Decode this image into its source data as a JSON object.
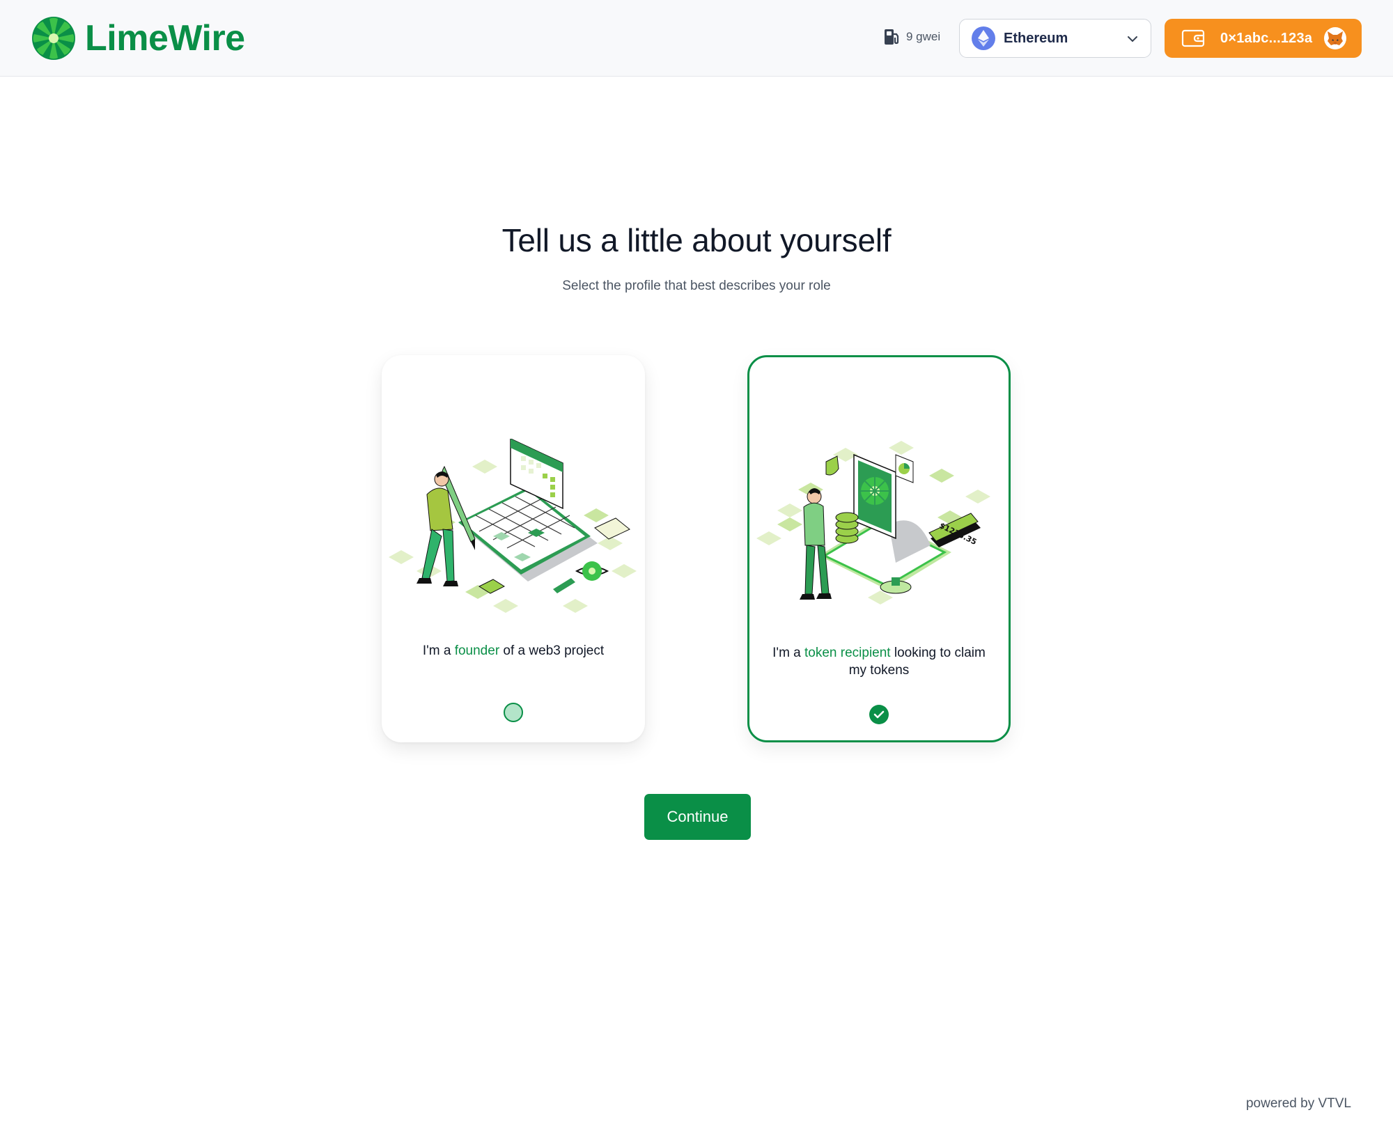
{
  "header": {
    "brand": "LimeWire",
    "gas_price": "9 gwei",
    "network": {
      "label": "Ethereum"
    },
    "wallet": {
      "address": "0×1abc...123a"
    }
  },
  "main": {
    "title": "Tell us a little about yourself",
    "subtitle": "Select the profile that best describes your role",
    "profiles": [
      {
        "prefix": "I'm a ",
        "highlight": "founder",
        "suffix": " of a web3 project",
        "selected": false
      },
      {
        "prefix": "I'm a ",
        "highlight": "token recipient",
        "suffix": " looking to claim my tokens",
        "selected": true,
        "illustration_amount": "$1225.35"
      }
    ],
    "continue_label": "Continue"
  },
  "footer": {
    "powered_by": "powered by VTVL"
  },
  "colors": {
    "brand_green": "#0a8f47",
    "wallet_orange": "#f7901e",
    "ethereum_blue": "#627eea"
  }
}
